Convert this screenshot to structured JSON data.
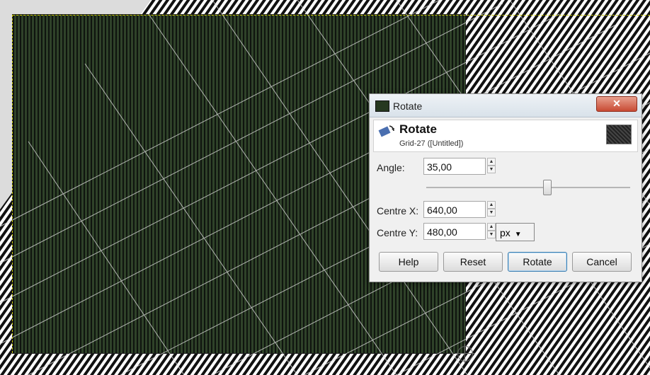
{
  "dialog": {
    "window_title": "Rotate",
    "close_symbol": "✕",
    "header": {
      "title": "Rotate",
      "subtitle": "Grid-27 ([Untitled])",
      "icon": "rotate-tool-icon"
    },
    "angle": {
      "label": "Angle:",
      "value": "35,00"
    },
    "centre_x": {
      "label": "Centre X:",
      "value": "640,00"
    },
    "centre_y": {
      "label": "Centre Y:",
      "value": "480,00"
    },
    "unit": {
      "value": "px",
      "icon": "dropdown-arrow-icon"
    },
    "buttons": {
      "help": "Help",
      "reset": "Reset",
      "rotate": "Rotate",
      "cancel": "Cancel"
    }
  }
}
